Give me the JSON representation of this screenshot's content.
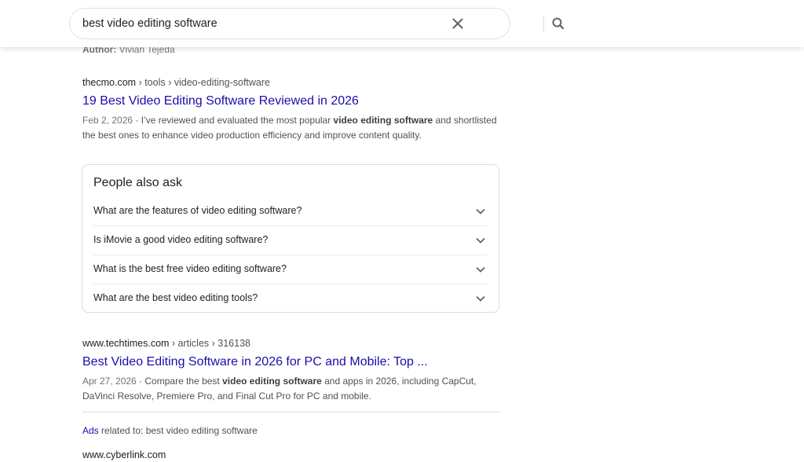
{
  "search": {
    "query": "best video editing software",
    "clear_icon": "close-icon",
    "search_icon": "search-icon"
  },
  "author": {
    "label": "Author:",
    "name": "Vivian Tejeda"
  },
  "results": [
    {
      "host": "thecmo.com",
      "path": " › tools › video-editing-software",
      "title": "19 Best Video Editing Software Reviewed in 2026",
      "date": "Feb 2, 2026",
      "snippet_pre": " · I’ve reviewed and evaluated the most popular ",
      "snippet_bold": "video editing software",
      "snippet_post": " and shortlisted the best ones to enhance video production efficiency and improve content quality."
    },
    {
      "host": "www.techtimes.com",
      "path": " › articles › 316138",
      "title": "Best Video Editing Software in 2026 for PC and Mobile: Top ...",
      "date": "Apr 27, 2026",
      "snippet_pre": " · Compare the best ",
      "snippet_bold": "video editing software",
      "snippet_post": " and apps in 2026, including CapCut, DaVinci Resolve, Premiere Pro, and Final Cut Pro for PC and mobile."
    }
  ],
  "people_also_ask": {
    "title": "People also ask",
    "questions": [
      "What are the features of video editing software?",
      "Is iMovie a good video editing software?",
      "What is the best free video editing software?",
      "What are the best video editing tools?"
    ]
  },
  "ads": {
    "label": "Ads",
    "text": " related to: best video editing software",
    "first_host": "www.cyberlink.com"
  },
  "colors": {
    "link": "#1a0dab",
    "text": "#202124",
    "muted": "#4d5156"
  }
}
